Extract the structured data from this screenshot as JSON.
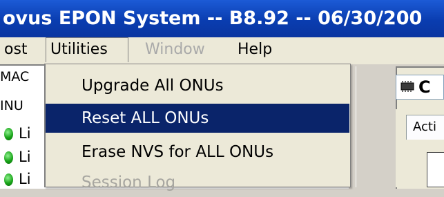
{
  "window": {
    "title": "ovus EPON System -- B8.92 -- 06/30/200"
  },
  "menubar": {
    "items": [
      {
        "label": "ost",
        "state": "normal"
      },
      {
        "label": "Utilities",
        "state": "open"
      },
      {
        "label": "Window",
        "state": "disabled"
      },
      {
        "label": "Help",
        "state": "normal"
      }
    ]
  },
  "left_panel": {
    "header_mac": "MAC",
    "header_onu": "INU",
    "rows": [
      {
        "label": "Li",
        "status_color": "#18a418"
      },
      {
        "label": "Li",
        "status_color": "#18a418"
      },
      {
        "label": "Li",
        "status_color": "#18a418"
      }
    ]
  },
  "right_panel": {
    "title_text": "C",
    "title_icon": "chip-icon",
    "tab_label": "Acti"
  },
  "utilities_menu": {
    "items": [
      {
        "label": "Upgrade All ONUs",
        "state": "normal"
      },
      {
        "label": "Reset ALL ONUs",
        "state": "selected"
      },
      {
        "label": "Erase NVS for ALL ONUs",
        "state": "normal"
      },
      {
        "label": "Session Log",
        "state": "disabled"
      }
    ]
  },
  "colors": {
    "title_bar": "#0a3db0",
    "menu_highlight": "#0a246a",
    "disabled_text": "#a7a6a0"
  }
}
